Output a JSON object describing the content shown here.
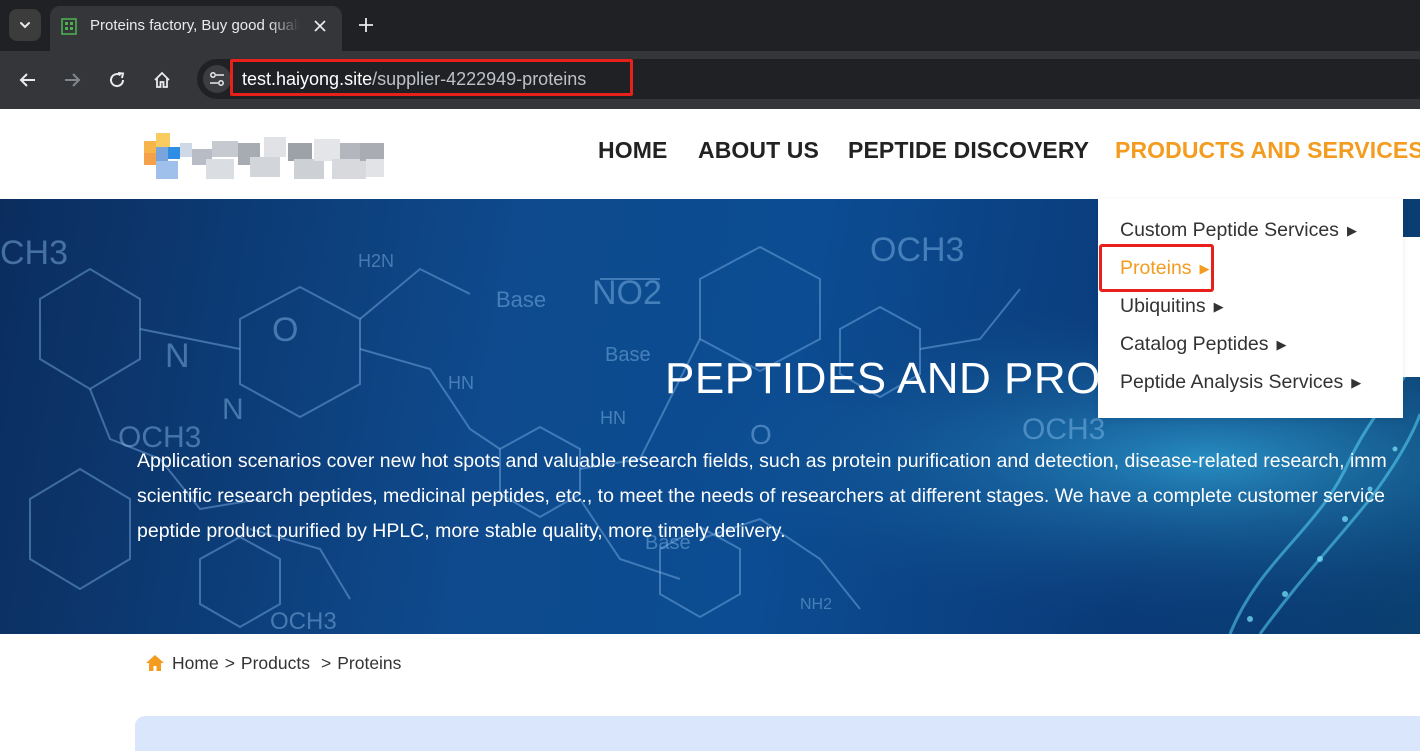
{
  "browser": {
    "tab_title": "Proteins factory, Buy good quality Proteins",
    "url_host": "test.haiyong.site",
    "url_path": "/supplier-4222949-proteins"
  },
  "nav": {
    "items": [
      "HOME",
      "ABOUT US",
      "PEPTIDE DISCOVERY",
      "PRODUCTS AND SERVICES"
    ],
    "active_color": "#f39c1f"
  },
  "dropdown": {
    "items": [
      "Custom Peptide Services",
      "Proteins",
      "Ubiquitins",
      "Catalog Peptides",
      "Peptide Analysis Services"
    ],
    "arrow": "▶",
    "active_index": 1
  },
  "hero": {
    "title": "PEPTIDES AND PRO",
    "desc_lines": [
      "Application scenarios cover new hot spots and valuable research fields, such as protein purification and detection, disease-related research, imm",
      "scientific research peptides, medicinal peptides, etc., to meet the needs of researchers at different stages. We have a complete customer service",
      "peptide product purified by HPLC, more stable quality, more timely delivery."
    ],
    "chem_labels": [
      "CH3",
      "OCH3",
      "NO2",
      "Base",
      "N",
      "O",
      "H2N",
      "OCH3",
      "Base",
      "HN",
      "N",
      "OCH3",
      "HN",
      "Base",
      "NH2",
      "OCH3",
      "O"
    ]
  },
  "breadcrumb": {
    "home": "Home",
    "sep": ">",
    "products": "Products",
    "current": "Proteins"
  },
  "colors": {
    "accent": "#f39c1f",
    "highlight_border": "#e8201c"
  }
}
